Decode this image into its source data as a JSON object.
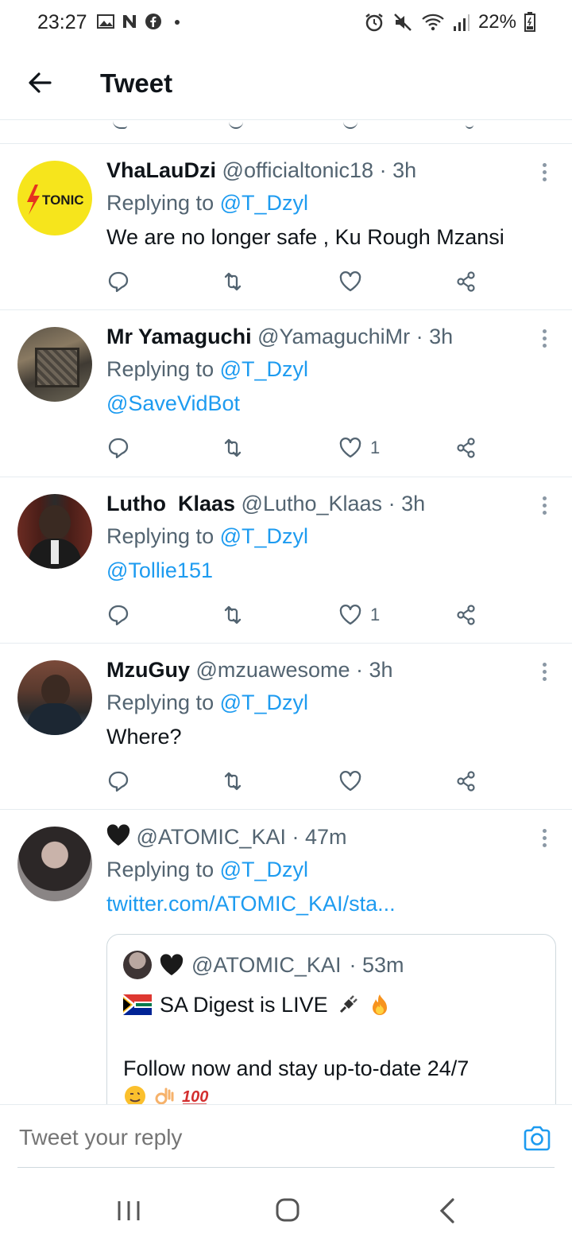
{
  "status_bar": {
    "time": "23:27",
    "battery": "22%",
    "icons": [
      "gallery-icon",
      "notification-n-icon",
      "facebook-icon",
      "dot-icon",
      "alarm-icon",
      "mute-icon",
      "wifi-icon",
      "signal-icon",
      "battery-icon"
    ]
  },
  "header": {
    "title": "Tweet"
  },
  "tweets": [
    {
      "name": "VhaLauDzi",
      "handle": "@officialtonic18",
      "time": "· 3h",
      "replying_prefix": "Replying to",
      "replying_to": "@T_Dzyl",
      "body": "We are no longer safe , Ku Rough Mzansi",
      "likes": "",
      "avatar_text": "TONIC"
    },
    {
      "name": "Mr Yamaguchi",
      "handle": "@YamaguchiMr",
      "time": "· 3h",
      "replying_prefix": "Replying to",
      "replying_to": "@T_Dzyl",
      "body": "@SaveVidBot",
      "likes": "1"
    },
    {
      "name": "Lutho  Klaas",
      "handle": "@Lutho_Klaas",
      "time": "· 3h",
      "replying_prefix": "Replying to",
      "replying_to": "@T_Dzyl",
      "body": "@Tollie151",
      "likes": "1"
    },
    {
      "name": "MzuGuy",
      "handle": "@mzuawesome",
      "time": "· 3h",
      "replying_prefix": "Replying to",
      "replying_to": "@T_Dzyl",
      "body": "Where?",
      "likes": ""
    },
    {
      "name": "",
      "handle": "@ATOMIC_KAI",
      "time": "· 47m",
      "replying_prefix": "Replying to",
      "replying_to": "@T_Dzyl",
      "body": "twitter.com/ATOMIC_KAI/sta...",
      "likes": "",
      "quote": {
        "handle": "@ATOMIC_KAI",
        "time": "· 53m",
        "line1": "SA Digest is LIVE",
        "line2": "Follow now and stay up-to-date 24/7"
      }
    }
  ],
  "composer": {
    "placeholder": "Tweet your reply"
  },
  "colors": {
    "accent": "#1d9bf0",
    "text": "#0f1419",
    "muted": "#536471",
    "border": "#e6ecf0"
  }
}
